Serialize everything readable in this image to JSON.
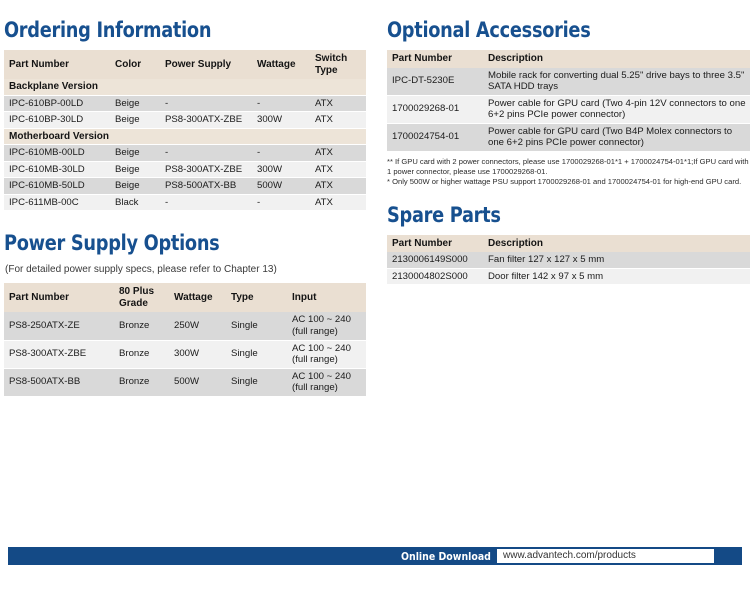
{
  "ordering": {
    "title": "Ordering Information",
    "columns": [
      "Part Number",
      "Color",
      "Power Supply",
      "Wattage",
      "Switch Type"
    ],
    "groups": [
      {
        "label": "Backplane Version",
        "rows": [
          [
            "IPC-610BP-00LD",
            "Beige",
            "-",
            "-",
            "ATX"
          ],
          [
            "IPC-610BP-30LD",
            "Beige",
            "PS8-300ATX-ZBE",
            "300W",
            "ATX"
          ]
        ]
      },
      {
        "label": "Motherboard Version",
        "rows": [
          [
            "IPC-610MB-00LD",
            "Beige",
            "-",
            "-",
            "ATX"
          ],
          [
            "IPC-610MB-30LD",
            "Beige",
            "PS8-300ATX-ZBE",
            "300W",
            "ATX"
          ],
          [
            "IPC-610MB-50LD",
            "Beige",
            "PS8-500ATX-BB",
            "500W",
            "ATX"
          ],
          [
            "IPC-611MB-00C",
            "Black",
            "-",
            "-",
            "ATX"
          ]
        ]
      }
    ]
  },
  "power_supply": {
    "title": "Power Supply Options",
    "subtitle": "(For detailed power supply specs, please refer to Chapter 13)",
    "columns": [
      "Part Number",
      "80 Plus Grade",
      "Wattage",
      "Type",
      "Input"
    ],
    "rows": [
      [
        "PS8-250ATX-ZE",
        "Bronze",
        "250W",
        "Single",
        "AC 100 ~ 240 (full range)"
      ],
      [
        "PS8-300ATX-ZBE",
        "Bronze",
        "300W",
        "Single",
        "AC 100 ~ 240 (full range)"
      ],
      [
        "PS8-500ATX-BB",
        "Bronze",
        "500W",
        "Single",
        "AC 100 ~ 240 (full range)"
      ]
    ]
  },
  "optional_accessories": {
    "title": "Optional Accessories",
    "columns": [
      "Part Number",
      "Description"
    ],
    "rows": [
      [
        "IPC-DT-5230E",
        "Mobile rack for converting dual 5.25\" drive bays to three 3.5\" SATA HDD trays"
      ],
      [
        "1700029268-01",
        "Power cable for GPU card (Two 4-pin 12V connectors to one 6+2 pins PCIe power connector)"
      ],
      [
        "1700024754-01",
        "Power cable for GPU card (Two B4P Molex connectors to one 6+2 pins PCIe power connector)"
      ]
    ],
    "footnotes": [
      "** If GPU card with 2 power connectors, please use 1700029268-01*1 + 1700024754-01*1;If GPU card with 1 power connector, please use 1700029268-01.",
      "* Only 500W or higher wattage PSU support 1700029268-01 and 1700024754-01 for high-end GPU card."
    ]
  },
  "spare_parts": {
    "title": "Spare Parts",
    "columns": [
      "Part Number",
      "Description"
    ],
    "rows": [
      [
        "2130006149S000",
        "Fan filter 127 x 127 x 5 mm"
      ],
      [
        "2130004802S000",
        "Door filter 142 x 97 x 5 mm"
      ]
    ]
  },
  "footer": {
    "label": "Online Download",
    "url": "www.advantech.com/products"
  },
  "colors": {
    "heading_blue": "#17508f",
    "header_beige": "#eadfd2",
    "group_beige": "#ede4d8",
    "row_dark": "#d9d9d9",
    "row_light": "#f1f1f1",
    "footer_blue": "#144a86"
  }
}
